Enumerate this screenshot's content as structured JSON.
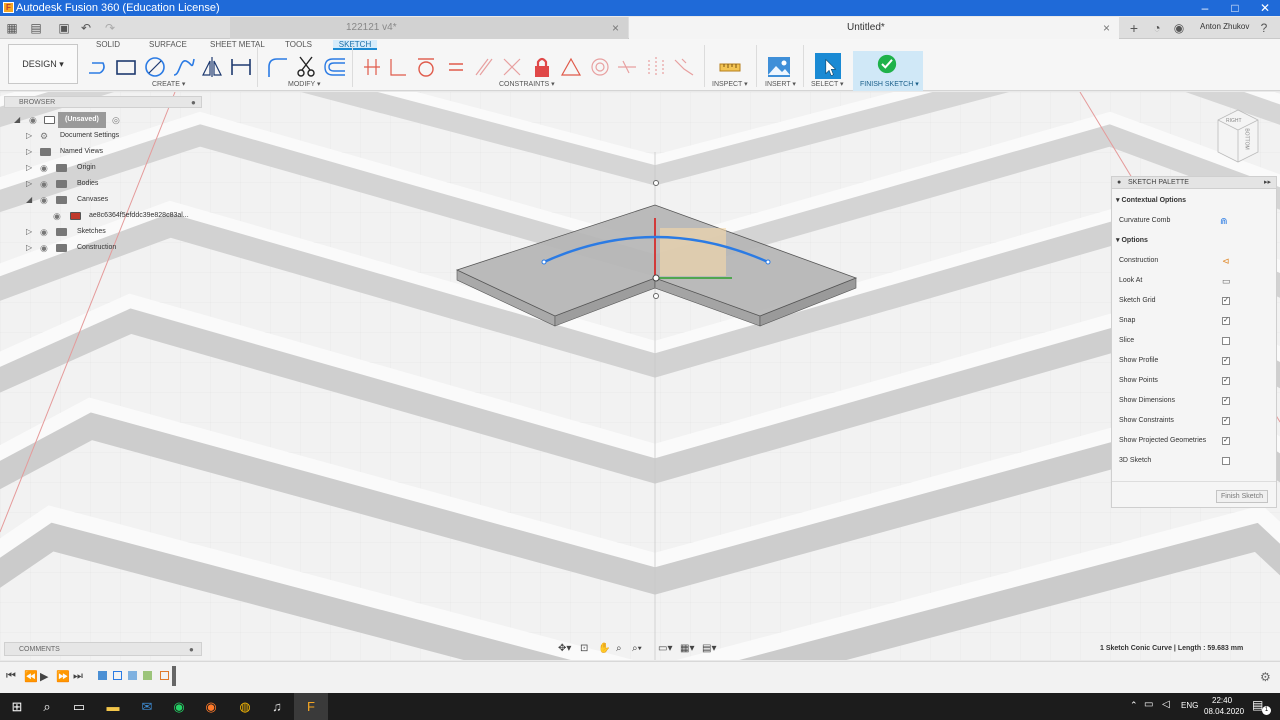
{
  "window": {
    "title": "Autodesk Fusion 360 (Education License)"
  },
  "tabs": [
    {
      "label": "122121 v4*",
      "active": false
    },
    {
      "label": "Untitled*",
      "active": true
    }
  ],
  "user": {
    "name": "Anton Zhukov"
  },
  "ribbon": {
    "mode_label": "DESIGN",
    "tabs": [
      "SOLID",
      "SURFACE",
      "SHEET METAL",
      "TOOLS",
      "SKETCH"
    ],
    "active_tab": "SKETCH",
    "groups": {
      "create": "CREATE",
      "modify": "MODIFY",
      "constraints": "CONSTRAINTS",
      "inspect": "INSPECT",
      "insert": "INSERT",
      "select": "SELECT",
      "finish": "FINISH SKETCH"
    }
  },
  "browser": {
    "title": "BROWSER",
    "items": [
      {
        "label": "(Unsaved)",
        "indent": 0
      },
      {
        "label": "Document Settings",
        "indent": 1
      },
      {
        "label": "Named Views",
        "indent": 1
      },
      {
        "label": "Origin",
        "indent": 1
      },
      {
        "label": "Bodies",
        "indent": 1
      },
      {
        "label": "Canvases",
        "indent": 1
      },
      {
        "label": "ae8c6364f5efddc39e828c83al...",
        "indent": 2
      },
      {
        "label": "Sketches",
        "indent": 1
      },
      {
        "label": "Construction",
        "indent": 1
      }
    ]
  },
  "viewcube": {
    "right": "RIGHT",
    "bottom": "BOTTOM"
  },
  "palette": {
    "title": "SKETCH PALETTE",
    "contextual_title": "Contextual Options",
    "curvature_comb": "Curvature Comb",
    "options_title": "Options",
    "options": [
      {
        "label": "Construction",
        "type": "icon"
      },
      {
        "label": "Look At",
        "type": "icon"
      },
      {
        "label": "Sketch Grid",
        "checked": true
      },
      {
        "label": "Snap",
        "checked": true
      },
      {
        "label": "Slice",
        "checked": false
      },
      {
        "label": "Show Profile",
        "checked": true
      },
      {
        "label": "Show Points",
        "checked": true
      },
      {
        "label": "Show Dimensions",
        "checked": true
      },
      {
        "label": "Show Constraints",
        "checked": true
      },
      {
        "label": "Show Projected Geometries",
        "checked": true
      },
      {
        "label": "3D Sketch",
        "checked": false
      }
    ],
    "finish_button": "Finish Sketch"
  },
  "comments": {
    "title": "COMMENTS"
  },
  "status": {
    "text": "1 Sketch Conic Curve | Length : 59.683 mm"
  },
  "taskbar": {
    "lang": "ENG",
    "time": "22:40",
    "date": "08.04.2020",
    "notifications": "1"
  },
  "colors": {
    "accent": "#1a8ad4",
    "curve": "#2b7be4",
    "titlebar": "#1f6ad8",
    "finish_green": "#1fb24a"
  }
}
